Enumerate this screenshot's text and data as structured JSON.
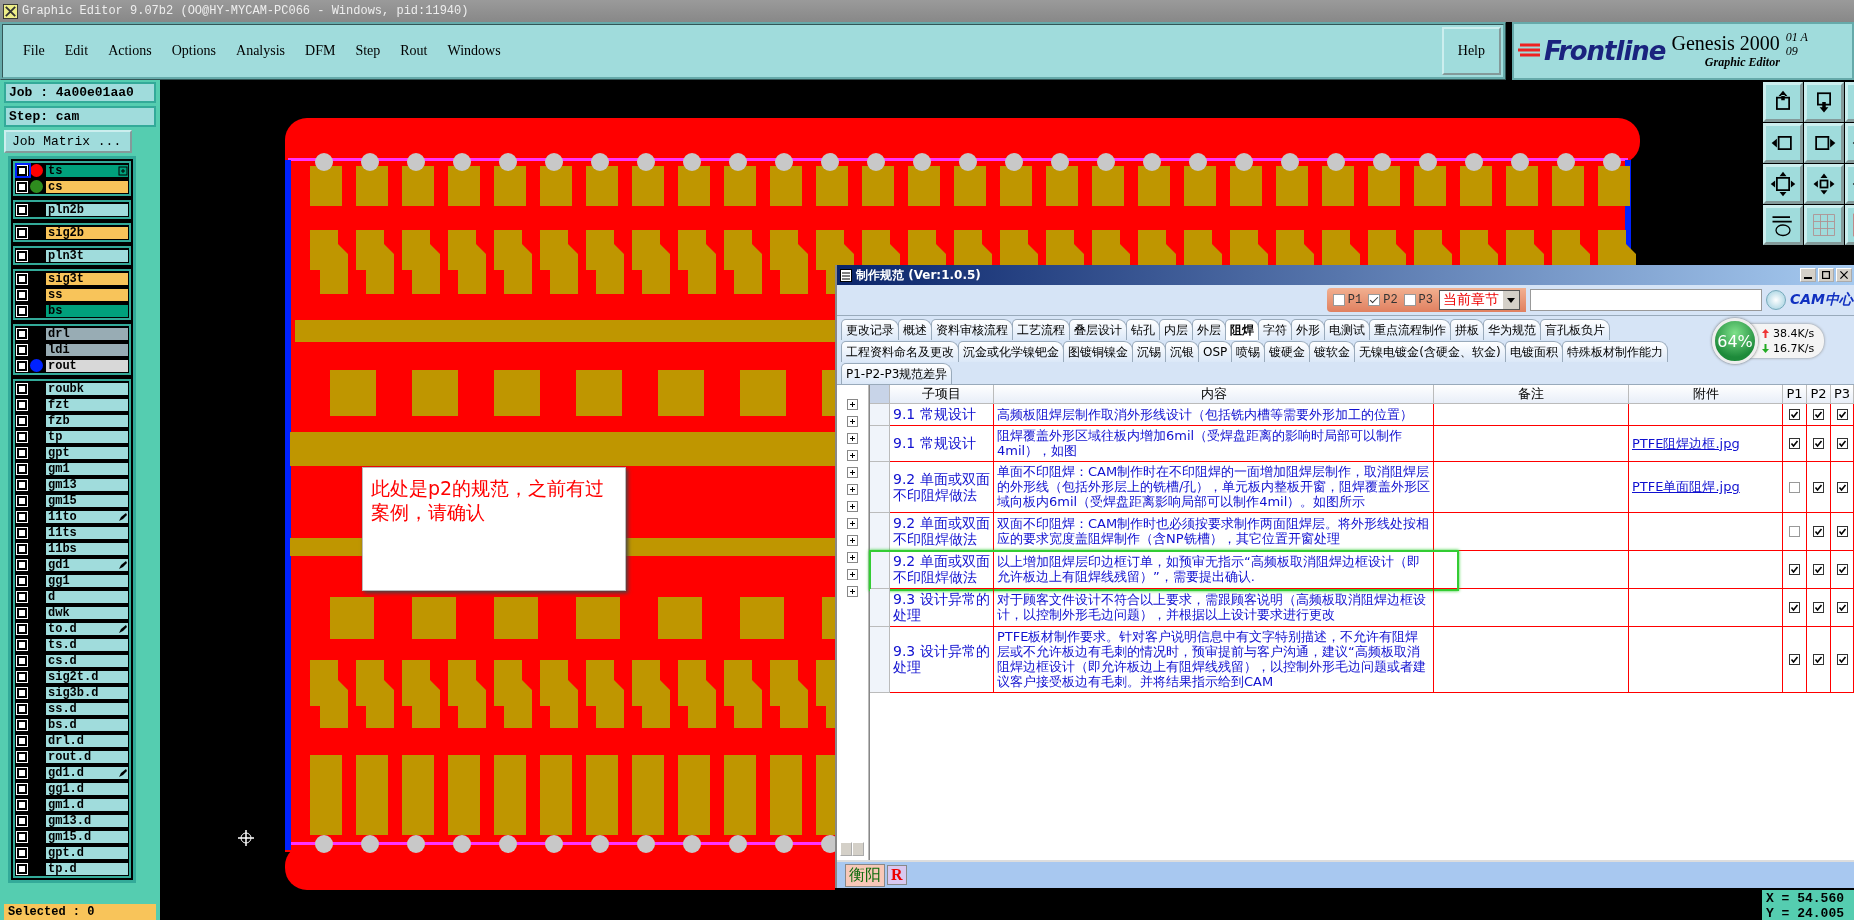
{
  "window": {
    "title": "Graphic Editor 9.07b2 (OO@HY-MYCAM-PC066 - Windows, pid:11940)"
  },
  "menu": [
    "File",
    "Edit",
    "Actions",
    "Options",
    "Analysis",
    "DFM",
    "Step",
    "Rout",
    "Windows"
  ],
  "help": "Help",
  "logo": {
    "brand": "Frontline",
    "product": "Genesis 2000",
    "subtitle": "Graphic Editor",
    "date_1": "01 A",
    "date_2": "09"
  },
  "job": {
    "job": "Job : 4a00e01aa0",
    "step": "Step: cam",
    "matrix_button": "Job Matrix ..."
  },
  "layer_groups": [
    [
      {
        "name": "ts",
        "color": "#00a07c",
        "dot": {
          "color": "#ff0000"
        },
        "checked": false,
        "selected": true,
        "marker": {
          "kind": "box"
        }
      },
      {
        "name": "cs",
        "color": "#f8c45a",
        "dot": {
          "color": "#2e8b1e"
        },
        "checked": false,
        "selected": false
      }
    ],
    [
      {
        "name": "pln2b",
        "color": "#a0dcdc",
        "checked": false,
        "selected": false
      }
    ],
    [
      {
        "name": "sig2b",
        "color": "#f8c45a",
        "checked": false,
        "selected": false
      }
    ],
    [
      {
        "name": "pln3t",
        "color": "#a0dcdc",
        "checked": false,
        "selected": false
      }
    ],
    [
      {
        "name": "sig3t",
        "color": "#f8c45a",
        "checked": false,
        "selected": false
      },
      {
        "name": "ss",
        "color": "#f8c45a",
        "checked": false,
        "selected": false
      },
      {
        "name": "bs",
        "color": "#00a07c",
        "checked": false,
        "selected": false
      }
    ],
    [
      {
        "name": "drl",
        "color": "#98acb4",
        "checked": false,
        "selected": false
      },
      {
        "name": "ldi",
        "color": "#98acb4",
        "checked": false,
        "selected": false
      },
      {
        "name": "rout",
        "color": "#d8d8d8",
        "dot": {
          "color": "#0022ff"
        },
        "checked": false,
        "selected": false
      }
    ],
    [
      {
        "name": "roubk",
        "color": "#a0dcdc",
        "checked": false,
        "selected": false
      },
      {
        "name": "fzt",
        "color": "#a0dcdc",
        "checked": false,
        "selected": false
      },
      {
        "name": "fzb",
        "color": "#a0dcdc",
        "checked": false,
        "selected": false
      },
      {
        "name": "tp",
        "color": "#a0dcdc",
        "checked": false,
        "selected": false
      },
      {
        "name": "gpt",
        "color": "#a0dcdc",
        "checked": false,
        "selected": false
      },
      {
        "name": "gm1",
        "color": "#a0dcdc",
        "checked": false,
        "selected": false
      },
      {
        "name": "gm13",
        "color": "#a0dcdc",
        "checked": false,
        "selected": false
      },
      {
        "name": "gm15",
        "color": "#a0dcdc",
        "checked": false,
        "selected": false
      },
      {
        "name": "11to",
        "color": "#a0dcdc",
        "checked": false,
        "selected": false,
        "marker": {
          "kind": "pen"
        }
      },
      {
        "name": "11ts",
        "color": "#a0dcdc",
        "checked": false,
        "selected": false
      },
      {
        "name": "11bs",
        "color": "#a0dcdc",
        "checked": false,
        "selected": false
      },
      {
        "name": "gd1",
        "color": "#a0dcdc",
        "checked": false,
        "selected": false,
        "marker": {
          "kind": "pen"
        }
      },
      {
        "name": "gg1",
        "color": "#a0dcdc",
        "checked": false,
        "selected": false
      },
      {
        "name": "d",
        "color": "#a0dcdc",
        "checked": false,
        "selected": false
      },
      {
        "name": "dwk",
        "color": "#a0dcdc",
        "checked": false,
        "selected": false
      },
      {
        "name": "to.d",
        "color": "#a0dcdc",
        "checked": false,
        "selected": false,
        "marker": {
          "kind": "pen"
        }
      },
      {
        "name": "ts.d",
        "color": "#a0dcdc",
        "checked": false,
        "selected": false
      },
      {
        "name": "cs.d",
        "color": "#a0dcdc",
        "checked": false,
        "selected": false
      },
      {
        "name": "sig2t.d",
        "color": "#a0dcdc",
        "checked": false,
        "selected": false
      },
      {
        "name": "sig3b.d",
        "color": "#a0dcdc",
        "checked": false,
        "selected": false
      },
      {
        "name": "ss.d",
        "color": "#a0dcdc",
        "checked": false,
        "selected": false
      },
      {
        "name": "bs.d",
        "color": "#a0dcdc",
        "checked": false,
        "selected": false
      },
      {
        "name": "drl.d",
        "color": "#a0dcdc",
        "checked": false,
        "selected": false
      },
      {
        "name": "rout.d",
        "color": "#a0dcdc",
        "checked": false,
        "selected": false
      },
      {
        "name": "gd1.d",
        "color": "#a0dcdc",
        "checked": false,
        "selected": false,
        "marker": {
          "kind": "pen"
        }
      },
      {
        "name": "gg1.d",
        "color": "#a0dcdc",
        "checked": false,
        "selected": false
      },
      {
        "name": "gm1.d",
        "color": "#a0dcdc",
        "checked": false,
        "selected": false
      },
      {
        "name": "gm13.d",
        "color": "#a0dcdc",
        "checked": false,
        "selected": false
      },
      {
        "name": "gm15.d",
        "color": "#a0dcdc",
        "checked": false,
        "selected": false
      },
      {
        "name": "gpt.d",
        "color": "#a0dcdc",
        "checked": false,
        "selected": false
      },
      {
        "name": "tp.d",
        "color": "#a0dcdc",
        "checked": false,
        "selected": false
      }
    ]
  ],
  "selected_count": "Selected : 0",
  "canvas": {
    "note": "此处是p2的规范，之前有过案例，请确认"
  },
  "coordinates": {
    "x": "X = 54.560",
    "y": "Y = 24.005"
  },
  "spec_window": {
    "title": "制作规范 (Ver:1.0.5)",
    "filters": [
      {
        "label": "P1",
        "checked": false
      },
      {
        "label": "P2",
        "checked": true
      },
      {
        "label": "P3",
        "checked": false
      }
    ],
    "scope": "当前章节",
    "cam_logo": "CAM中心",
    "speed": {
      "percent": "64%",
      "upload": "38.4K/s",
      "download": "16.7K/s"
    },
    "tab_rows": [
      [
        {
          "label": "更改记录",
          "selected": false
        },
        {
          "label": "概述",
          "selected": false
        },
        {
          "label": "资料审核流程",
          "selected": false
        },
        {
          "label": "工艺流程",
          "selected": false
        },
        {
          "label": "叠层设计",
          "selected": false
        },
        {
          "label": "钻孔",
          "selected": false
        },
        {
          "label": "内层",
          "selected": false
        },
        {
          "label": "外层",
          "selected": false
        },
        {
          "label": "阻焊",
          "selected": true
        },
        {
          "label": "字符",
          "selected": false
        },
        {
          "label": "外形",
          "selected": false
        },
        {
          "label": "电测试",
          "selected": false
        },
        {
          "label": "重点流程制作",
          "selected": false
        },
        {
          "label": "拼板",
          "selected": false
        },
        {
          "label": "华为规范",
          "selected": false
        },
        {
          "label": "盲孔板负片",
          "selected": false
        }
      ],
      [
        {
          "label": "工程资料命名及更改",
          "selected": false
        },
        {
          "label": "沉金或化学镍钯金",
          "selected": false
        },
        {
          "label": "图镀铜镍金",
          "selected": false
        },
        {
          "label": "沉锡",
          "selected": false
        },
        {
          "label": "沉银",
          "selected": false
        },
        {
          "label": "OSP",
          "selected": false
        },
        {
          "label": "喷锡",
          "selected": false
        },
        {
          "label": "镀硬金",
          "selected": false
        },
        {
          "label": "镀软金",
          "selected": false
        },
        {
          "label": "无镍电镀金(含硬金、软金)",
          "selected": false
        },
        {
          "label": "电镀面积",
          "selected": false
        },
        {
          "label": "特殊板材制作能力",
          "selected": false
        }
      ],
      [
        {
          "label": "P1-P2-P3规范差异",
          "selected": false
        }
      ]
    ],
    "tree": [
      {
        "expanded": false
      },
      {
        "expanded": false
      },
      {
        "expanded": false
      },
      {
        "expanded": false
      },
      {
        "expanded": false
      },
      {
        "expanded": false
      },
      {
        "expanded": false
      },
      {
        "expanded": false
      },
      {
        "expanded": false
      },
      {
        "expanded": false
      },
      {
        "expanded": false
      },
      {
        "expanded": false
      }
    ],
    "columns": [
      "子项目",
      "内容",
      "备注",
      "附件",
      "P1",
      "P2",
      "P3"
    ],
    "rows": [
      {
        "item": "9.1 常规设计",
        "content": "高频板阻焊层制作取消外形线设计（包括铣内槽等需要外形加工的位置）",
        "p1": true,
        "p2": true,
        "p3": true,
        "highlighted": false
      },
      {
        "item": "9.1 常规设计",
        "content": "阻焊覆盖外形区域往板内增加6mil（受焊盘距离的影响时局部可以制作4mil），如图",
        "attachment": "PTFE阻焊边框.jpg",
        "p1": true,
        "p2": true,
        "p3": true,
        "highlighted": false
      },
      {
        "item": "9.2 单面或双面不印阻焊做法",
        "content": "单面不印阻焊：CAM制作时在不印阻焊的一面增加阻焊层制作，取消阻焊层的外形线（包括外形层上的铣槽/孔），单元板内整板开窗，阻焊覆盖外形区域向板内6mil（受焊盘距离影响局部可以制作4mil）。如图所示",
        "attachment": "PTFE单面阻焊.jpg",
        "p1": false,
        "p2": true,
        "p3": true,
        "highlighted": false
      },
      {
        "item": "9.2 单面或双面不印阻焊做法",
        "content": "双面不印阻焊：CAM制作时也必须按要求制作两面阻焊层。将外形线处按相应的要求宽度盖阻焊制作（含NP铣槽），其它位置开窗处理",
        "p1": false,
        "p2": true,
        "p3": true,
        "highlighted": false
      },
      {
        "item": "9.2 单面或双面不印阻焊做法",
        "content": "以上增加阻焊层印边框订单，如预审无指示“高频板取消阻焊边框设计（即允许板边上有阻焊线残留）”，需要提出确认.",
        "p1": true,
        "p2": true,
        "p3": true,
        "highlighted": true
      },
      {
        "item": "9.3 设计异常的处理",
        "content": "对于顾客文件设计不符合以上要求，需跟顾客说明（高频板取消阻焊边框设计，以控制外形毛边问题），并根据以上设计要求进行更改",
        "p1": true,
        "p2": true,
        "p3": true,
        "highlighted": false
      },
      {
        "item": "9.3 设计异常的处理",
        "content": "PTFE板材制作要求。针对客户说明信息中有文字特别描述，不允许有阻焊层或不允许板边有毛刺的情况时，预审提前与客户沟通，建议“高频板取消阻焊边框设计（即允许板边上有阻焊线残留），以控制外形毛边问题或者建议客户接受板边有毛刺。并将结果指示给到CAM",
        "p1": true,
        "p2": true,
        "p3": true,
        "highlighted": false
      }
    ],
    "bottom_tabs": [
      {
        "label": "衡阳",
        "selected": true
      },
      {
        "label": "R",
        "selected": false
      }
    ]
  }
}
